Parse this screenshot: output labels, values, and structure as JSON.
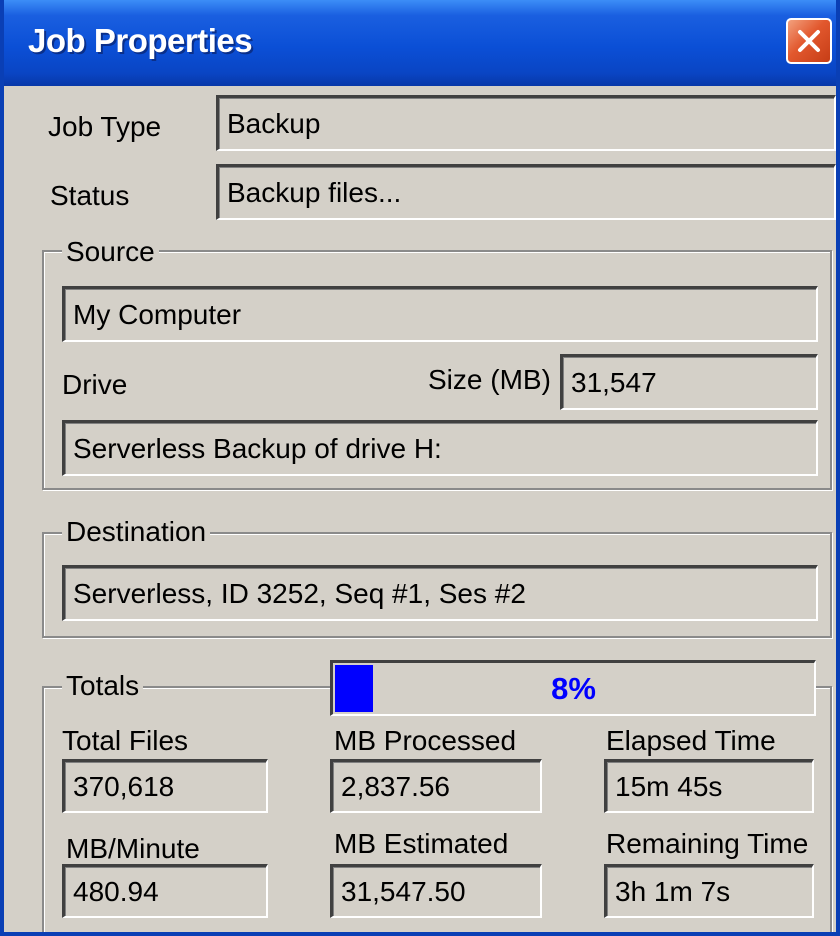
{
  "window": {
    "title": "Job Properties",
    "close_label": "close"
  },
  "job": {
    "type_label": "Job Type",
    "type_value": "Backup",
    "status_label": "Status",
    "status_value": "Backup files..."
  },
  "source": {
    "group_title": "Source",
    "computer_value": "My Computer",
    "drive_label": "Drive",
    "size_label": "Size (MB)",
    "size_value": "31,547",
    "drive_value": "Serverless Backup of drive H:"
  },
  "destination": {
    "group_title": "Destination",
    "value": "Serverless, ID 3252, Seq #1, Ses #2"
  },
  "totals": {
    "group_title": "Totals",
    "progress_percent": 8,
    "progress_label": "8%",
    "total_files_label": "Total Files",
    "total_files_value": "370,618",
    "mb_processed_label": "MB Processed",
    "mb_processed_value": "2,837.56",
    "elapsed_time_label": "Elapsed Time",
    "elapsed_time_value": "15m 45s",
    "mb_per_minute_label": "MB/Minute",
    "mb_per_minute_value": "480.94",
    "mb_estimated_label": "MB Estimated",
    "mb_estimated_value": "31,547.50",
    "remaining_time_label": "Remaining Time",
    "remaining_time_value": "3h 1m 7s"
  },
  "colors": {
    "titlebar_blue": "#0b4fd6",
    "dialog_gray": "#d4d0c8",
    "progress_blue": "#0000ff",
    "close_red": "#e2582e"
  }
}
